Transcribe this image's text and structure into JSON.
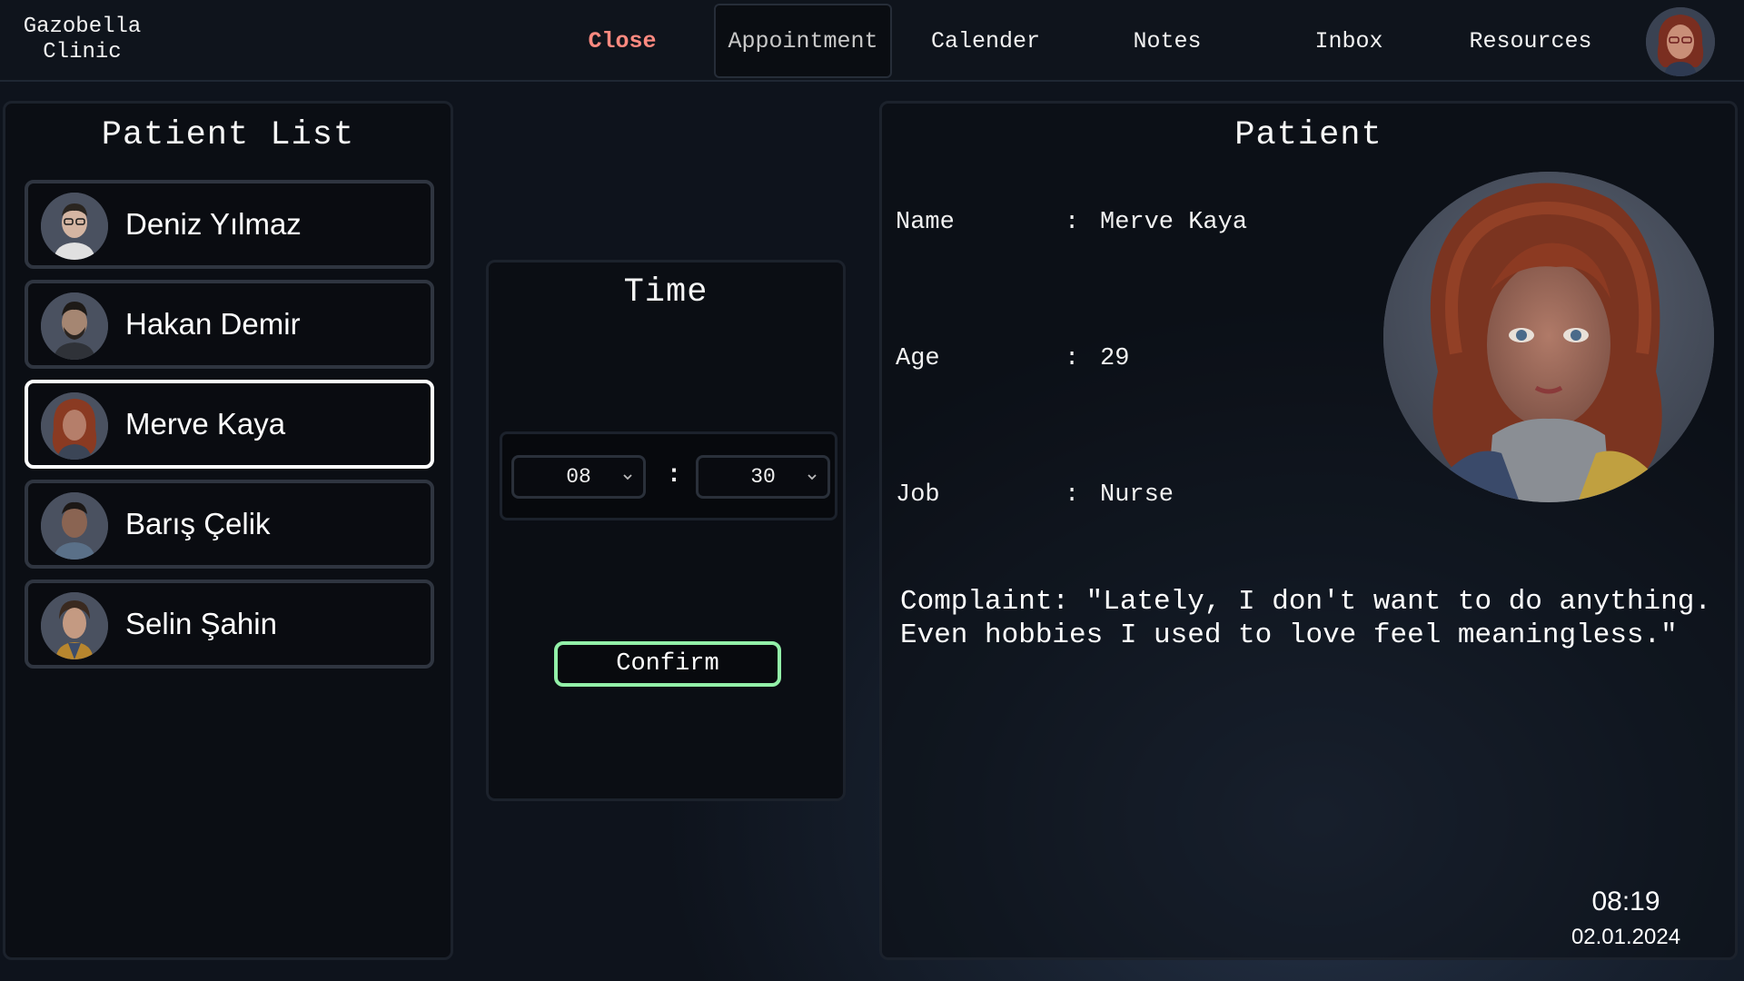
{
  "app": {
    "brand": "Gazobella\nClinic"
  },
  "nav": {
    "close": "Close",
    "appointment": "Appointment",
    "calender": "Calender",
    "notes": "Notes",
    "inbox": "Inbox",
    "resources": "Resources"
  },
  "patient_list": {
    "title": "Patient List",
    "items": [
      {
        "name": "Deniz Yılmaz",
        "selected": false
      },
      {
        "name": "Hakan Demir",
        "selected": false
      },
      {
        "name": "Merve Kaya",
        "selected": true
      },
      {
        "name": "Barış Çelik",
        "selected": false
      },
      {
        "name": "Selin Şahin",
        "selected": false
      }
    ]
  },
  "time": {
    "title": "Time",
    "hour": "08",
    "separator": ":",
    "minute": "30",
    "confirm_label": "Confirm"
  },
  "patient": {
    "title": "Patient",
    "name_label": "Name",
    "name_value": "Merve Kaya",
    "age_label": "Age",
    "age_value": "29",
    "job_label": "Job",
    "job_value": "Nurse",
    "colon": ":",
    "complaint": "Complaint: \"Lately, I don't want to do anything. Even hobbies I used to love feel meaningless.\""
  },
  "clock": {
    "time": "08:19",
    "date": "02.01.2024"
  },
  "colors": {
    "accent_close": "#ff8a80",
    "confirm_border": "#92f0a8",
    "selected_border": "#ffffff"
  }
}
